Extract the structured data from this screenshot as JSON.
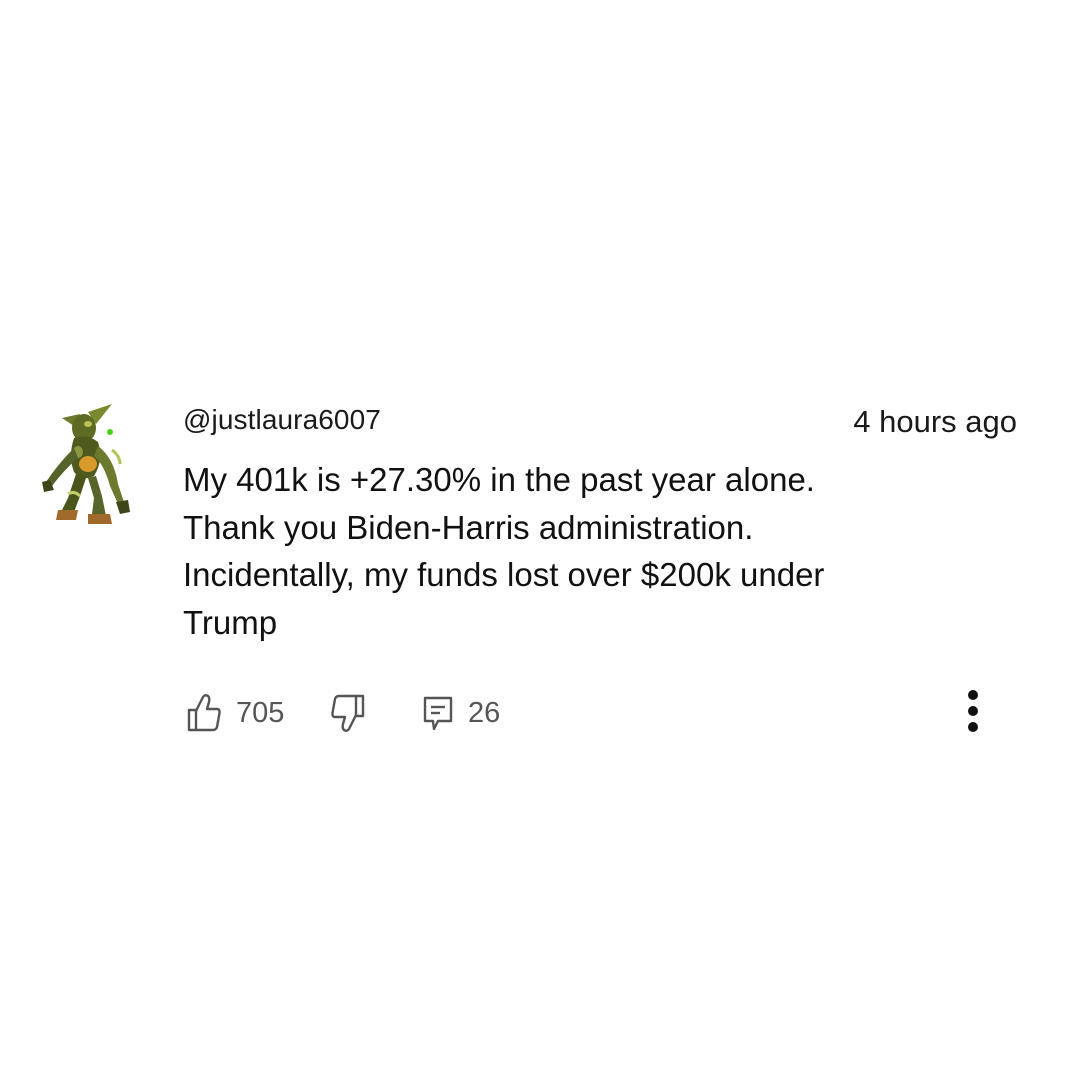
{
  "comment": {
    "author": "@justlaura6007",
    "timestamp": "4 hours ago",
    "avatar_icon": "goblin-character-avatar",
    "body_lines": [
      "My 401k is +27.30% in the past year alone.",
      "Thank you Biden-Harris administration.",
      "Incidentally, my funds lost over $200k under",
      "Trump"
    ],
    "actions": {
      "like_icon": "thumbs-up-icon",
      "like_count": "705",
      "dislike_icon": "thumbs-down-icon",
      "reply_icon": "comment-icon",
      "reply_count": "26",
      "more_icon": "more-vertical-icon"
    }
  }
}
